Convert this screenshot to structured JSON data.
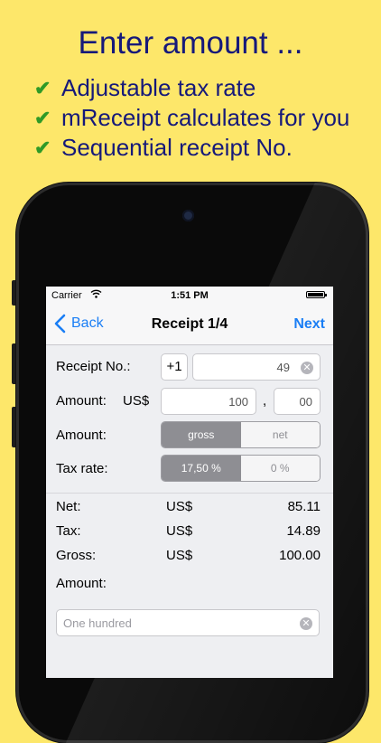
{
  "promo": {
    "title": "Enter amount ...",
    "features": [
      "Adjustable tax rate",
      "mReceipt calculates for you",
      "Sequential receipt No."
    ]
  },
  "status_bar": {
    "carrier": "Carrier",
    "time": "1:51 PM"
  },
  "nav": {
    "back_label": "Back",
    "title": "Receipt 1/4",
    "next_label": "Next"
  },
  "form": {
    "receipt_no_label": "Receipt No.:",
    "increment_label": "+1",
    "receipt_no_value": "49",
    "amount_label": "Amount:",
    "currency": "US$",
    "amount_integer": "100",
    "decimal_separator": ",",
    "amount_decimal": "00",
    "amount_type_label": "Amount:",
    "amount_type_options": [
      "gross",
      "net"
    ],
    "amount_type_selected": "gross",
    "tax_rate_label": "Tax rate:",
    "tax_rate_options": [
      "17,50 %",
      "0 %"
    ],
    "tax_rate_selected": "17,50 %"
  },
  "summary": [
    {
      "label": "Net:",
      "currency": "US$",
      "value": "85.11"
    },
    {
      "label": "Tax:",
      "currency": "US$",
      "value": "14.89"
    },
    {
      "label": "Gross:",
      "currency": "US$",
      "value": "100.00"
    }
  ],
  "words": {
    "label": "Amount:",
    "placeholder": "One hundred"
  },
  "colors": {
    "background": "#fde76a",
    "promo_text": "#16197a",
    "check": "#2f9a27",
    "accent": "#1a7ef5",
    "segment_selected": "#8e8e93"
  }
}
